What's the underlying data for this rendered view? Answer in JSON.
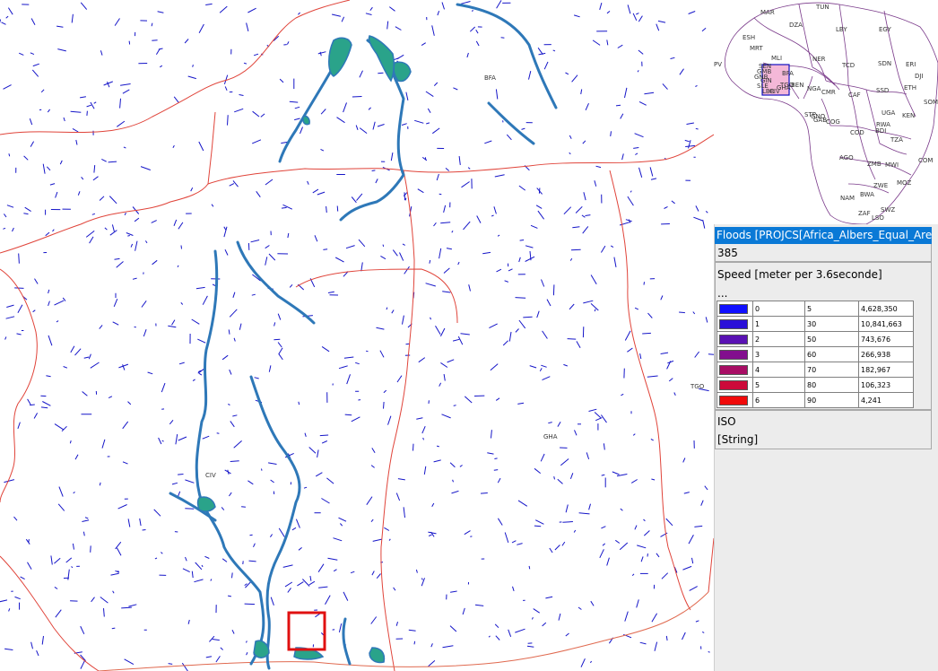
{
  "main_map": {
    "labels": [
      {
        "text": "BFA",
        "key": "bfa"
      },
      {
        "text": "CIV",
        "key": "civ"
      },
      {
        "text": "GHA",
        "key": "gha"
      },
      {
        "text": "TGO",
        "key": "tgo"
      }
    ],
    "border_color": "#e0443a",
    "river_color": "#2e78b8",
    "flood_color": "#2aa38a",
    "water_pixel_color": "#1515c8",
    "selection_box_color": "#e01010"
  },
  "overview_map": {
    "labels": [
      "TUN",
      "MAR",
      "DZA",
      "LBY",
      "EGY",
      "ESH",
      "MRT",
      "MLI",
      "NER",
      "TCD",
      "SDN",
      "ERI",
      "PV",
      "SEN",
      "GMB",
      "GNB",
      "GIN",
      "SLE",
      "LBR",
      "CIV",
      "BFA",
      "GHA",
      "TGO",
      "BEN",
      "NGA",
      "CMR",
      "CAF",
      "SSD",
      "ETH",
      "DJI",
      "SOM",
      "STP",
      "GAB",
      "GNQ",
      "COG",
      "COD",
      "UGA",
      "KEN",
      "RWA",
      "BDI",
      "TZA",
      "AGO",
      "ZMB",
      "MWI",
      "MOZ",
      "NAM",
      "ZWE",
      "BWA",
      "ZAF",
      "SWZ",
      "LSO",
      "COM"
    ],
    "country_line_color": "#7a3a8a",
    "highlight_fill": "#f4b8d8",
    "highlight_border": "#1010c0"
  },
  "panel": {
    "layer_title": "Floods [PROJCS[Africa_Albers_Equal_Area_C",
    "feature_value": "385",
    "speed_label": "Speed [meter per 3.6seconde]",
    "ellipsis": "...",
    "legend_rows": [
      {
        "color": "#1010ff",
        "class": "0",
        "speed": "5",
        "count": "4,628,350"
      },
      {
        "color": "#2a10d8",
        "class": "1",
        "speed": "30",
        "count": "10,841,663"
      },
      {
        "color": "#5a12b4",
        "class": "2",
        "speed": "50",
        "count": "743,676"
      },
      {
        "color": "#820e8e",
        "class": "3",
        "speed": "60",
        "count": "266,938"
      },
      {
        "color": "#a80c64",
        "class": "4",
        "speed": "70",
        "count": "182,967"
      },
      {
        "color": "#cc0a3a",
        "class": "5",
        "speed": "80",
        "count": "106,323"
      },
      {
        "color": "#f00a0a",
        "class": "6",
        "speed": "90",
        "count": "4,241"
      }
    ],
    "iso_label": "ISO",
    "iso_type": "[String]"
  }
}
